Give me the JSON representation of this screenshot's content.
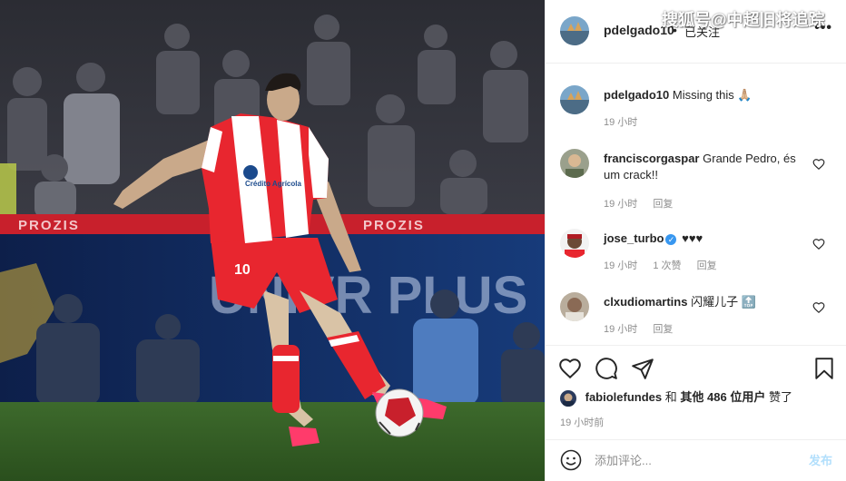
{
  "watermark": "搜狐号@中超旧将追踪",
  "post": {
    "username": "pdelgado10",
    "separator": "•",
    "follow_status": "已关注",
    "more_label": "•••"
  },
  "photo": {
    "shirt_sponsor": "Crédito Agrícola",
    "shirt_number": "10",
    "board_text": "PROZIS",
    "banner_text": "UNIVR PLUS"
  },
  "comments": [
    {
      "username": "pdelgado10",
      "text": "Missing this 🙏🏼",
      "time": "19 小时",
      "replies": "",
      "reply": "",
      "verified": false
    },
    {
      "username": "franciscorgaspar",
      "text": "Grande Pedro, és um crack!!",
      "time": "19 小时",
      "replies": "",
      "reply": "回复",
      "verified": false
    },
    {
      "username": "jose_turbo",
      "text": "♥♥♥",
      "time": "19 小时",
      "replies": "1 次赞",
      "reply": "回复",
      "verified": true
    },
    {
      "username": "clxudiomartins",
      "text": "闪耀儿子 🔝",
      "time": "19 小时",
      "replies": "",
      "reply": "回复",
      "verified": false
    }
  ],
  "likes": {
    "first": "fabiolefundes",
    "and": "和",
    "others": "其他 486 位用户",
    "suffix": "赞了"
  },
  "time_ago": "19 小时前",
  "composer": {
    "placeholder": "添加评论...",
    "post_label": "发布"
  },
  "icons": {
    "more": "more-icon",
    "like": "heart-icon",
    "comment": "comment-icon",
    "share": "share-icon",
    "save": "bookmark-icon",
    "emoji": "emoji-icon"
  },
  "colors": {
    "verified": "#3897f0",
    "post_button_disabled": "#b2dffc",
    "kit_red": "#e8262f"
  }
}
